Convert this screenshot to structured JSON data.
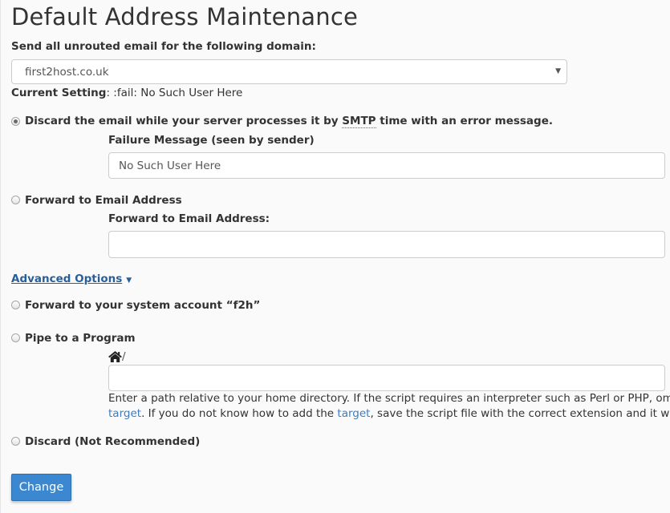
{
  "page": {
    "title": "Default Address Maintenance"
  },
  "domain": {
    "label": "Send all unrouted email for the following domain:",
    "selected": "first2host.co.uk"
  },
  "current_setting": {
    "label": "Current Setting",
    "separator": ":",
    "value": " :fail: No Such User Here"
  },
  "options": {
    "discard_smtp": {
      "label_before": "Discard the email while your server processes it by ",
      "abbr": "SMTP",
      "label_after": " time with an error message.",
      "checked": true,
      "failure_label": "Failure Message (seen by sender)",
      "failure_value": "No Such User Here"
    },
    "forward_email": {
      "label": "Forward to Email Address",
      "checked": false,
      "field_label": "Forward to Email Address:",
      "field_value": ""
    },
    "advanced": {
      "label": "Advanced Options"
    },
    "forward_system": {
      "label": "Forward to your system account “f2h”",
      "checked": false
    },
    "pipe": {
      "label": "Pipe to a Program",
      "checked": false,
      "path_prefix": "/",
      "field_value": "",
      "help_line1": "Enter a path relative to your home directory. If the script requires an interpreter such as Perl or PHP, omit th",
      "help_line2_a": ". If you do not know how to add the ",
      "help_line2_b": ", save the script file with the correct extension and it will be a",
      "help_link": "target"
    },
    "discard": {
      "label": "Discard (Not Recommended)",
      "checked": false
    }
  },
  "actions": {
    "change_label": "Change"
  },
  "colors": {
    "link": "#295f99",
    "help_link": "#3b7dc0",
    "primary_button": "#3b87d0",
    "background": "#fafafa"
  }
}
